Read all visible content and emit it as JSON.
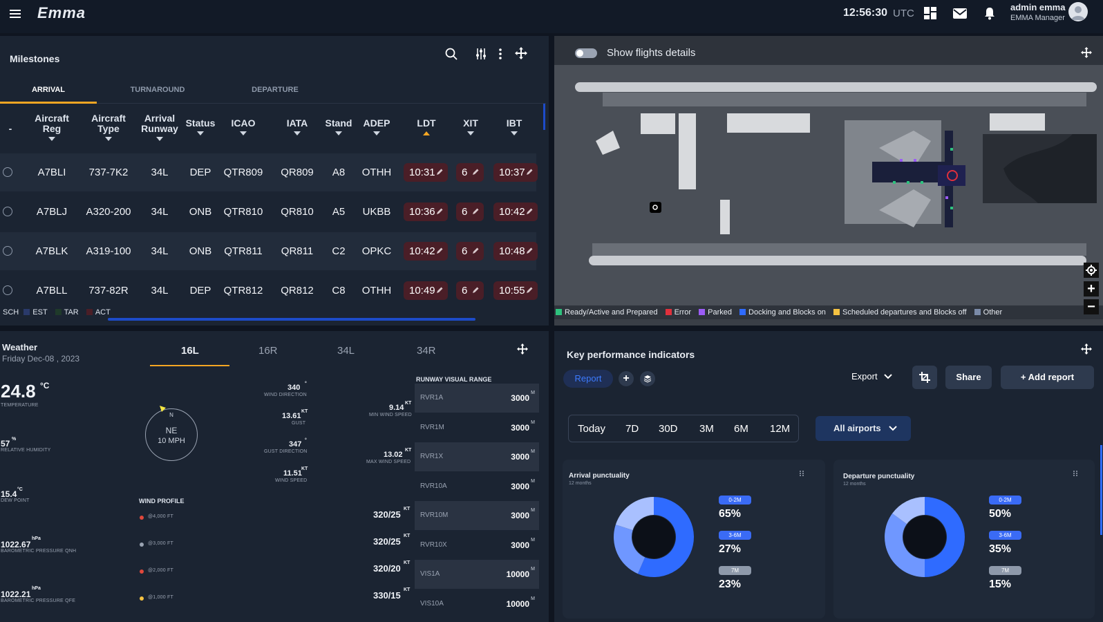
{
  "topbar": {
    "brand": "Emma",
    "time": "12:56:30",
    "timezone": "UTC",
    "user_name": "admin emma",
    "user_role": "EMMA Manager"
  },
  "milestones": {
    "title": "Milestones",
    "tabs": [
      "ARRIVAL",
      "TURNAROUND",
      "DEPARTURE"
    ],
    "columns": [
      "-",
      "Aircraft Reg",
      "Aircraft Type",
      "Arrival Runway",
      "Status",
      "ICAO",
      "IATA",
      "Stand",
      "ADEP",
      "LDT",
      "XIT",
      "IBT"
    ],
    "rows": [
      {
        "reg": "A7BLI",
        "type": "737-7K2",
        "runway": "34L",
        "status": "DEP",
        "icao": "QTR809",
        "iata": "QR809",
        "stand": "A8",
        "adep": "OTHH",
        "ldt": "10:31",
        "xit": "6",
        "ibt": "10:37"
      },
      {
        "reg": "A7BLJ",
        "type": "A320-200",
        "runway": "34L",
        "status": "ONB",
        "icao": "QTR810",
        "iata": "QR810",
        "stand": "A5",
        "adep": "UKBB",
        "ldt": "10:36",
        "xit": "6",
        "ibt": "10:42"
      },
      {
        "reg": "A7BLK",
        "type": "A319-100",
        "runway": "34L",
        "status": "ONB",
        "icao": "QTR811",
        "iata": "QR811",
        "stand": "C2",
        "adep": "OPKC",
        "ldt": "10:42",
        "xit": "6",
        "ibt": "10:48"
      },
      {
        "reg": "A7BLL",
        "type": "737-82R",
        "runway": "34L",
        "status": "DEP",
        "icao": "QTR812",
        "iata": "QR812",
        "stand": "C8",
        "adep": "OTHH",
        "ldt": "10:49",
        "xit": "6",
        "ibt": "10:55"
      }
    ],
    "legend": [
      {
        "label": "SCH",
        "color": "#5a6170"
      },
      {
        "label": "EST",
        "color": "#2a3a6a"
      },
      {
        "label": "TAR",
        "color": "#1f3a2a"
      },
      {
        "label": "ACT",
        "color": "#4a1e27"
      }
    ]
  },
  "map": {
    "toggle_label": "Show flights details",
    "legend": [
      {
        "label": "Ready/Active and Prepared",
        "color": "#2ec27e"
      },
      {
        "label": "Error",
        "color": "#e0303c"
      },
      {
        "label": "Parked",
        "color": "#9b5cf6"
      },
      {
        "label": "Docking and Blocks on",
        "color": "#2f6bff"
      },
      {
        "label": "Scheduled departures and Blocks off",
        "color": "#f5c242"
      },
      {
        "label": "Other",
        "color": "#7a8aa8"
      }
    ]
  },
  "weather": {
    "title": "Weather",
    "date": "Friday Dec-08 , 2023",
    "runway_tabs": [
      "16L",
      "16R",
      "34L",
      "34R"
    ],
    "temperature": "24.8",
    "temperature_unit": "°C",
    "temperature_label": "TEMPERATURE",
    "humidity": "57",
    "humidity_unit": "%",
    "humidity_label": "RELATIVE HUMIDITY",
    "dew_point": "15.4",
    "dew_point_unit": "°C",
    "dew_point_label": "DEW POINT",
    "qnh": "1022.67",
    "qnh_unit": "hPa",
    "qnh_label": "BAROMETRIC PRESSURE QNH",
    "qfe": "1022.21",
    "qfe_unit": "hPa",
    "qfe_label": "BAROMETRIC PRESSURE QFE",
    "compass_n": "N",
    "compass_dir": "NE",
    "compass_speed": "10 MPH",
    "wind_direction": "340",
    "wind_direction_label": "WIND DIRECTION",
    "gust": "13.61",
    "gust_label": "GUST",
    "gust_direction": "347",
    "gust_direction_label": "GUST DIRECTION",
    "wind_speed": "11.51",
    "wind_speed_label": "WIND SPEED",
    "min_wind_speed": "9.14",
    "min_wind_speed_label": "MIN WIND SPEED",
    "max_wind_speed": "13.02",
    "max_wind_speed_label": "MAX WIND SPEED",
    "deg_unit": "°",
    "kt_unit": "KT",
    "wind_profile_label": "WIND PROFILE",
    "wind_profile": [
      {
        "alt": "@4,000 FT",
        "value": "320/25",
        "color": "#e0483c"
      },
      {
        "alt": "@3,000 FT",
        "value": "320/25",
        "color": "#9aa3b2"
      },
      {
        "alt": "@2,000 FT",
        "value": "320/20",
        "color": "#e0483c"
      },
      {
        "alt": "@1,000 FT",
        "value": "330/15",
        "color": "#f5c242"
      }
    ],
    "rvr_title": "RUNWAY VISUAL RANGE",
    "rvr": [
      {
        "name": "RVR1A",
        "value": "3000"
      },
      {
        "name": "RVR1M",
        "value": "3000"
      },
      {
        "name": "RVR1X",
        "value": "3000"
      },
      {
        "name": "RVR10A",
        "value": "3000"
      },
      {
        "name": "RVR10M",
        "value": "3000"
      },
      {
        "name": "RVR10X",
        "value": "3000"
      },
      {
        "name": "VIS1A",
        "value": "10000"
      },
      {
        "name": "VIS10A",
        "value": "10000"
      }
    ],
    "rvr_unit": "M"
  },
  "kpi": {
    "title": "Key performance indicators",
    "report_label": "Report",
    "export_label": "Export",
    "share_label": "Share",
    "add_report_label": "+ Add report",
    "ranges": [
      "Today",
      "7D",
      "30D",
      "3M",
      "6M",
      "12M"
    ],
    "airports_label": "All airports",
    "cards": [
      {
        "title": "Arrival punctuality",
        "subtitle": "12 months",
        "items": [
          {
            "badge": "0-2M",
            "pct": "65%",
            "value": 65
          },
          {
            "badge": "3-6M",
            "pct": "27%",
            "value": 27
          },
          {
            "badge": "7M",
            "pct": "23%",
            "value": 23
          }
        ]
      },
      {
        "title": "Departure punctuality",
        "subtitle": "12 months",
        "items": [
          {
            "badge": "0-2M",
            "pct": "50%",
            "value": 50
          },
          {
            "badge": "3-6M",
            "pct": "35%",
            "value": 35
          },
          {
            "badge": "7M",
            "pct": "15%",
            "value": 15
          }
        ]
      }
    ]
  }
}
